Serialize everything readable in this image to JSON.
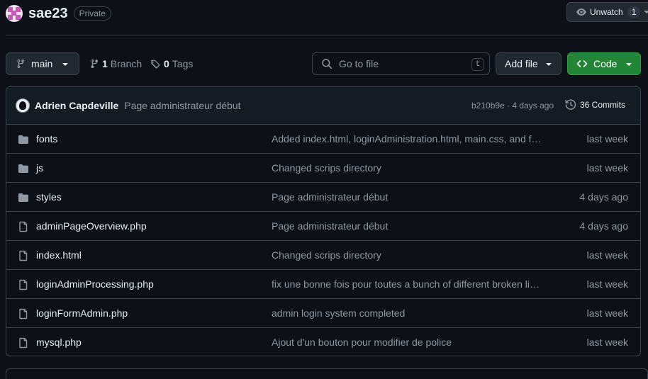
{
  "repo": {
    "name": "sae23",
    "visibility": "Private"
  },
  "watch": {
    "label": "Unwatch",
    "count": "1"
  },
  "toolbar": {
    "branch": "main",
    "branches_count": "1",
    "branches_label": "Branch",
    "tags_count": "0",
    "tags_label": "Tags",
    "search_placeholder": "Go to file",
    "search_shortcut": "t",
    "add_file": "Add file",
    "code": "Code"
  },
  "latest_commit": {
    "author": "Adrien Capdeville",
    "message": "Page administrateur début",
    "meta": "b210b9e · 4 days ago",
    "commits": "36 Commits"
  },
  "files": [
    {
      "type": "folder",
      "name": "fonts",
      "message": "Added index.html, loginAdministration.html, main.css, and font files",
      "date": "last week"
    },
    {
      "type": "folder",
      "name": "js",
      "message": "Changed scrips directory",
      "date": "last week"
    },
    {
      "type": "folder",
      "name": "styles",
      "message": "Page administrateur début",
      "date": "4 days ago"
    },
    {
      "type": "file",
      "name": "adminPageOverview.php",
      "message": "Page administrateur début",
      "date": "4 days ago"
    },
    {
      "type": "file",
      "name": "index.html",
      "message": "Changed scrips directory",
      "date": "last week"
    },
    {
      "type": "file",
      "name": "loginAdminProcessing.php",
      "message": "fix une bonne fois pour toutes a bunch of different broken links",
      "date": "last week"
    },
    {
      "type": "file",
      "name": "loginFormAdmin.php",
      "message": "admin login system completed",
      "date": "last week"
    },
    {
      "type": "file",
      "name": "mysql.php",
      "message": "Ajout d'un bouton pour modifier de police",
      "date": "last week"
    }
  ],
  "colors": {
    "accent": "#238636",
    "background": "#0d1117",
    "muted": "#9198a1",
    "border": "#3d444d"
  }
}
